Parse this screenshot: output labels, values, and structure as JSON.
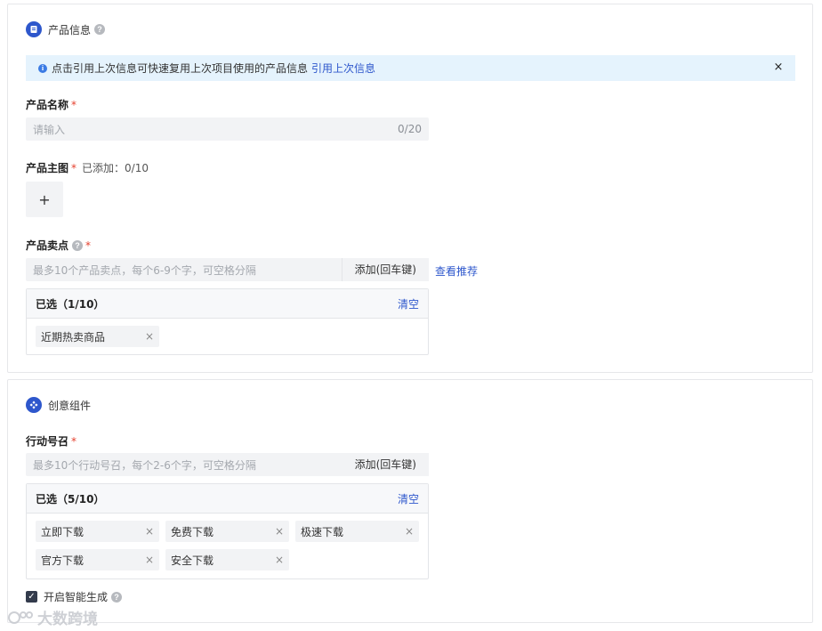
{
  "product": {
    "section_title": "产品信息",
    "icon": "document-icon",
    "notice": {
      "text": "点击引用上次信息可快速复用上次项目使用的产品信息",
      "link": "引用上次信息",
      "close": "×"
    },
    "name": {
      "label": "产品名称",
      "required": "*",
      "placeholder": "请输入",
      "counter": "0/20"
    },
    "image": {
      "label": "产品主图",
      "required": "*",
      "count_text": "已添加：0/10",
      "upload": "+"
    },
    "selling_points": {
      "label": "产品卖点",
      "required": "*",
      "placeholder": "最多10个产品卖点，每个6-9个字，可空格分隔",
      "add_button": "添加(回车键)",
      "recommend_link": "查看推荐",
      "selected_title": "已选（1/10）",
      "clear": "清空",
      "tags": [
        "近期热卖商品"
      ]
    }
  },
  "creative": {
    "section_title": "创意组件",
    "icon": "components-icon",
    "cta": {
      "label": "行动号召",
      "required": "*",
      "placeholder": "最多10个行动号召，每个2-6个字，可空格分隔",
      "add_button": "添加(回车键)",
      "selected_title": "已选（5/10）",
      "clear": "清空",
      "tags": [
        "立即下载",
        "免费下载",
        "极速下载",
        "官方下载",
        "安全下载"
      ]
    },
    "smart_gen": {
      "label": "开启智能生成",
      "checked": true
    }
  },
  "watermark": "大数跨境",
  "colors": {
    "accent": "#2e57cc",
    "required": "#e5412e",
    "notice_bg": "#e5f3fd"
  }
}
